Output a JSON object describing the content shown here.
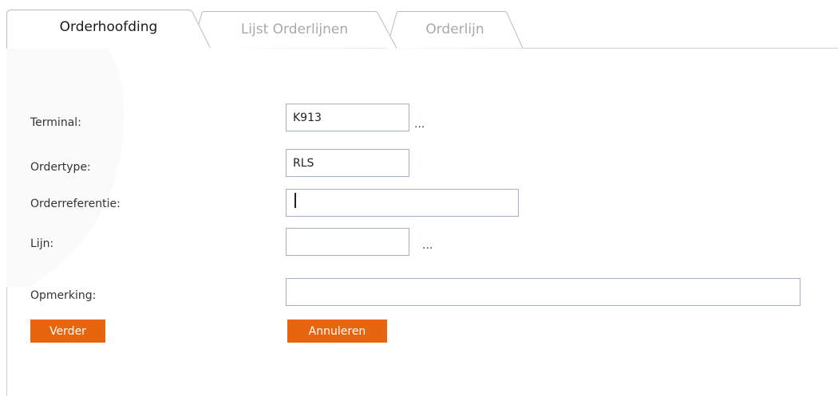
{
  "tabs": [
    {
      "label": "Orderhoofding",
      "active": true
    },
    {
      "label": "Lijst Orderlijnen",
      "active": false
    },
    {
      "label": "Orderlijn",
      "active": false
    }
  ],
  "form": {
    "terminal": {
      "label": "Terminal:",
      "value": "K913",
      "lookup": "..."
    },
    "ordertype": {
      "label": "Ordertype:",
      "value": "RLS"
    },
    "orderreferentie": {
      "label": "Orderreferentie:",
      "value": ""
    },
    "lijn": {
      "label": "Lijn:",
      "value": "",
      "lookup": "..."
    },
    "opmerking": {
      "label": "Opmerking:",
      "value": ""
    }
  },
  "buttons": {
    "verder": "Verder",
    "annuleren": "Annuleren"
  },
  "colors": {
    "button": "#e8650f",
    "field_border": "#9fb0c8",
    "inactive_tab_text": "#a8a8a8"
  }
}
